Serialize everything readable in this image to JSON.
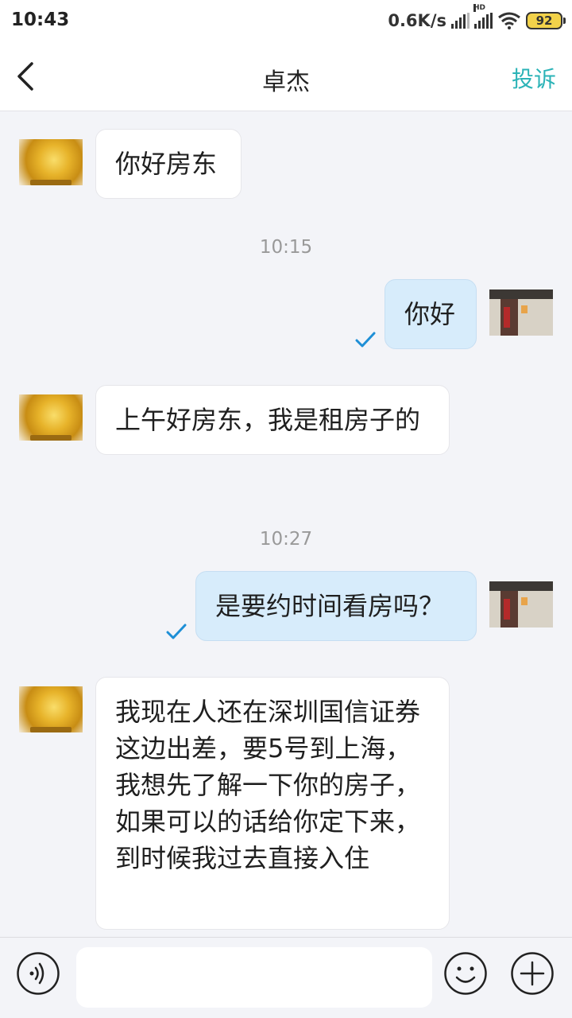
{
  "status_bar": {
    "time": "10:43",
    "net_speed": "0.6K/s",
    "hd_label": "HD",
    "battery": "92"
  },
  "header": {
    "title": "卓杰",
    "complain_label": "投诉"
  },
  "messages": [
    {
      "side": "in",
      "text": "你好房东"
    },
    {
      "timestamp": "10:15"
    },
    {
      "side": "out",
      "text": "你好",
      "read": true
    },
    {
      "side": "in",
      "text": "上午好房东，我是租房子的"
    },
    {
      "timestamp": "10:27"
    },
    {
      "side": "out",
      "text": "是要约时间看房吗？",
      "read": true
    },
    {
      "side": "in",
      "text": "我现在人还在深圳国信证券这边出差，要5号到上海，我想先了解一下你的房子，如果可以的话给你定下来，到时候我过去直接入住"
    }
  ],
  "input_bar": {
    "placeholder": ""
  },
  "colors": {
    "accent": "#2bb3b7",
    "outgoing_bubble": "#d7ecfb",
    "check": "#1e8fd6"
  }
}
